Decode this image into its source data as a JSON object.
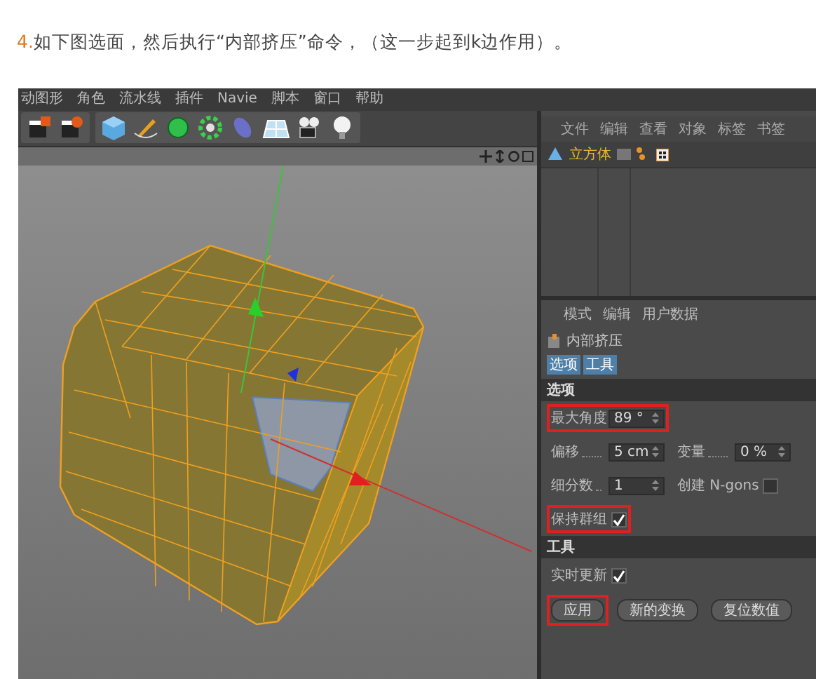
{
  "heading": {
    "number": "4.",
    "text": "如下图选面，然后执行“内部挤压”命令，（这一步起到k边作用）。"
  },
  "menu_bar": [
    "动图形",
    "角色",
    "流水线",
    "插件",
    "Naviе",
    "脚本",
    "窗口",
    "帮助"
  ],
  "object_manager": {
    "menu": [
      "文件",
      "编辑",
      "查看",
      "对象",
      "标签",
      "书签"
    ],
    "objects": [
      {
        "name": "立方体"
      }
    ]
  },
  "attributes": {
    "menu": [
      "模式",
      "编辑",
      "用户数据"
    ],
    "tool_name": "内部挤压",
    "tabs": [
      {
        "label": "选项",
        "selected": true
      },
      {
        "label": "工具",
        "selected": true
      }
    ],
    "sections": [
      {
        "title": "选项",
        "rows": [
          [
            {
              "kind": "number",
              "label": "最大角度",
              "value": "89 °",
              "highlighted": true
            }
          ],
          [
            {
              "kind": "number",
              "label": "偏移",
              "value": "5 cm",
              "highlighted": false
            },
            {
              "kind": "number",
              "label": "变量",
              "value": "0 %",
              "highlighted": false
            }
          ],
          [
            {
              "kind": "number",
              "label": "细分数",
              "value": "1",
              "highlighted": false
            },
            {
              "kind": "checkbox",
              "label": "创建 N-gons",
              "checked": false,
              "highlighted": false
            }
          ],
          [
            {
              "kind": "checkbox",
              "label": "保持群组",
              "checked": true,
              "highlighted": true
            }
          ]
        ]
      },
      {
        "title": "工具",
        "rows": [
          [
            {
              "kind": "checkbox",
              "label": "实时更新",
              "checked": true,
              "highlighted": false
            }
          ],
          [
            {
              "kind": "button",
              "label": "应用",
              "highlighted": true
            },
            {
              "kind": "button",
              "label": "新的变换",
              "highlighted": false
            },
            {
              "kind": "button",
              "label": "复位数值",
              "highlighted": false
            }
          ]
        ]
      }
    ]
  }
}
